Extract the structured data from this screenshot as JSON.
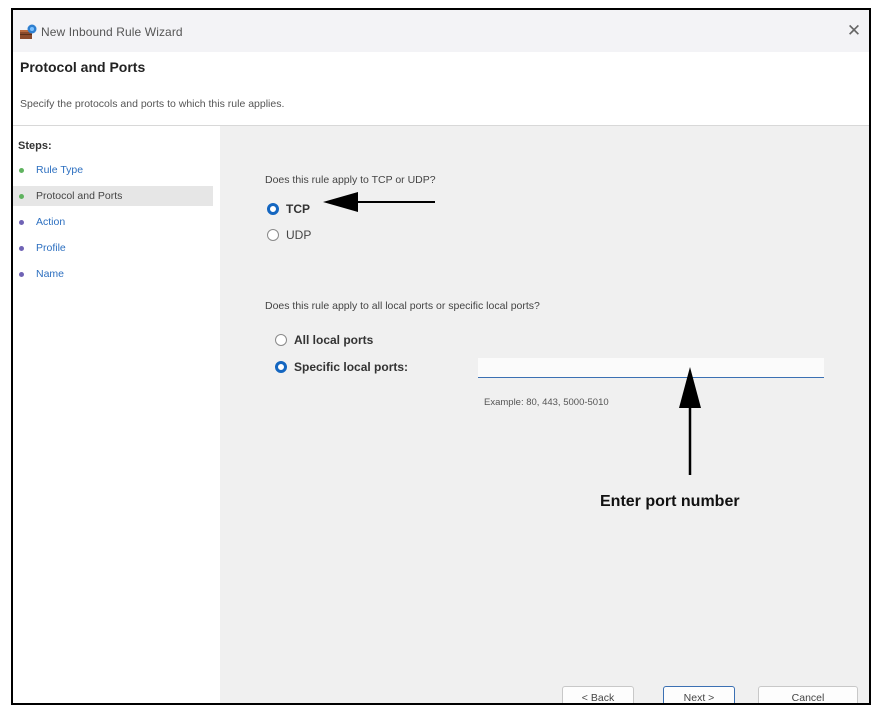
{
  "window": {
    "title": "New Inbound Rule Wizard",
    "close_glyph": "✕"
  },
  "header": {
    "heading": "Protocol and Ports",
    "description": "Specify the protocols and ports to which this rule applies."
  },
  "steps": {
    "label": "Steps:",
    "items": [
      {
        "label": "Rule Type",
        "state": "done",
        "bullet_color": "#5fb35f"
      },
      {
        "label": "Protocol and Ports",
        "state": "current",
        "bullet_color": "#5fb35f"
      },
      {
        "label": "Action",
        "state": "pending",
        "bullet_color": "#6f63b5"
      },
      {
        "label": "Profile",
        "state": "pending",
        "bullet_color": "#6f63b5"
      },
      {
        "label": "Name",
        "state": "pending",
        "bullet_color": "#6f63b5"
      }
    ]
  },
  "protocol": {
    "question": "Does this rule apply to TCP or UDP?",
    "options": [
      {
        "label": "TCP",
        "checked": true
      },
      {
        "label": "UDP",
        "checked": false
      }
    ]
  },
  "ports": {
    "question": "Does this rule apply to all local ports or specific local ports?",
    "options": [
      {
        "label": "All local ports",
        "checked": false
      },
      {
        "label": "Specific local ports:",
        "checked": true
      }
    ],
    "input_value": "",
    "example": "Example: 80, 443, 5000-5010"
  },
  "annotation": {
    "text": "Enter port number"
  },
  "buttons": {
    "back": "< Back",
    "next": "Next >",
    "cancel": "Cancel"
  },
  "colors": {
    "accent": "#1466c0",
    "content_bg": "#f0f0f0",
    "done_step": "#5fb35f",
    "pending_step": "#6f63b5"
  },
  "icons": {
    "app": "firewall-icon",
    "close": "close-icon"
  }
}
